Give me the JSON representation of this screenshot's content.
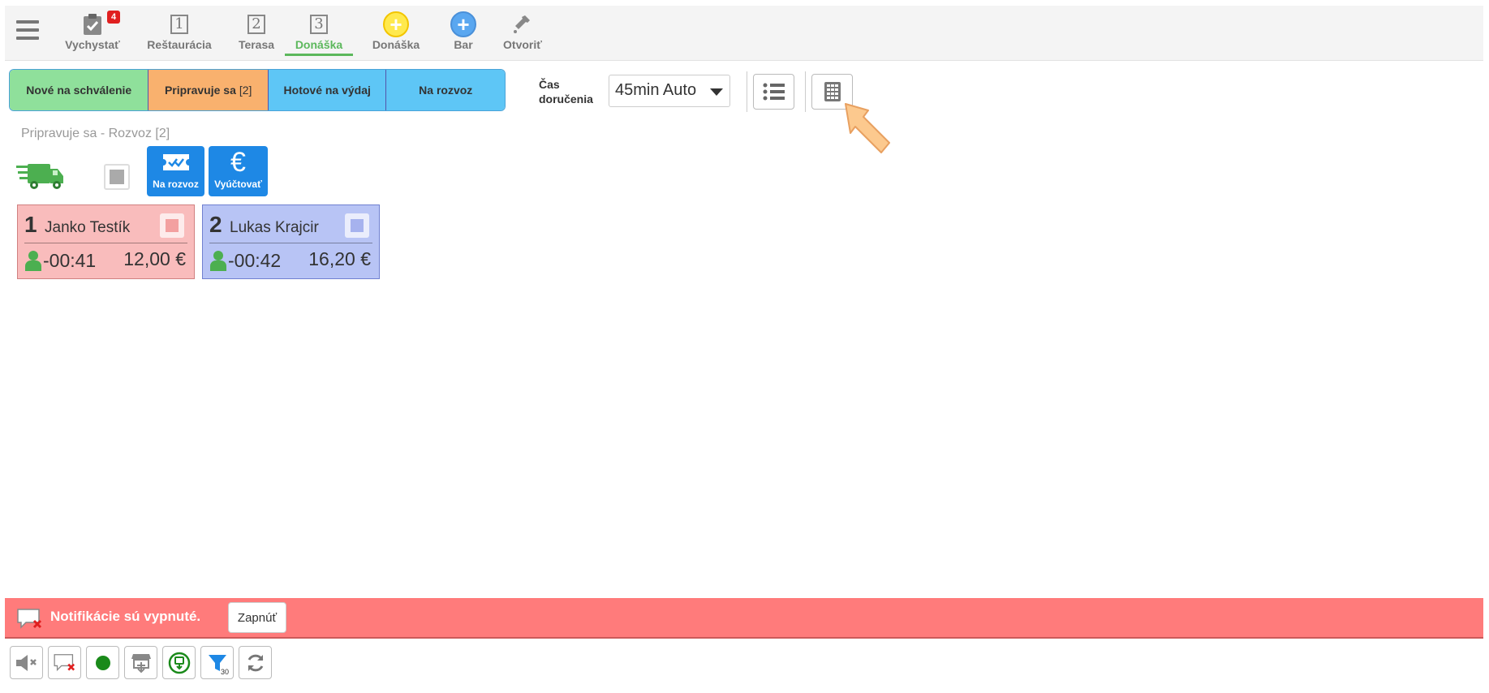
{
  "nav": {
    "items": [
      {
        "label": "Vychystať",
        "badge": "4",
        "icon": "clipboard-check-icon"
      },
      {
        "label": "Reštaurácia",
        "icon_text": "1"
      },
      {
        "label": "Terasa",
        "icon_text": "2"
      },
      {
        "label": "Donáška",
        "icon_text": "3",
        "active": true
      },
      {
        "label": "Donáška",
        "icon": "plus-circle-yellow-icon",
        "icon_text": "+"
      },
      {
        "label": "Bar",
        "icon": "plus-circle-blue-icon",
        "icon_text": "+"
      },
      {
        "label": "Otvoriť",
        "icon": "bottle-icon"
      }
    ]
  },
  "filters": {
    "new_label": "Nové na schválenie",
    "prep_label": "Pripravuje sa",
    "prep_count": "[2]",
    "ready_label": "Hotové na výdaj",
    "delivery_label": "Na rozvoz"
  },
  "delivery_time": {
    "label_line1": "Čas",
    "label_line2": "doručenia",
    "value": "45min Auto"
  },
  "section_title": "Pripravuje sa - Rozvoz [2]",
  "actions": {
    "na_rozvoz_label": "Na rozvoz",
    "vyuctovat_label": "Vyúčtovať",
    "euro_symbol": "€"
  },
  "orders": [
    {
      "number": "1",
      "name": "Janko Testík",
      "time": "-00:41",
      "price": "12,00 €",
      "color": "#f9bcbc"
    },
    {
      "number": "2",
      "name": "Lukas Krajcir",
      "time": "-00:42",
      "price": "16,20 €",
      "color": "#b8c4f5"
    }
  ],
  "notification": {
    "text": "Notifikácie sú vypnuté.",
    "button_label": "Zapnúť"
  },
  "bottom_tools": {
    "filter_count": "30"
  },
  "colors": {
    "accent_green": "#5cb85c",
    "notif_red": "#ff7b7b",
    "action_blue": "#1e88e5",
    "filter_new": "#8fe09b",
    "filter_prep": "#f9b16e",
    "filter_ready": "#5ec6f6"
  }
}
